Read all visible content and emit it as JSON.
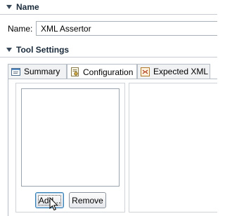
{
  "sections": {
    "name": {
      "title": "Name"
    },
    "tool_settings": {
      "title": "Tool Settings"
    }
  },
  "name_field": {
    "label": "Name:",
    "value": "XML Assertor"
  },
  "tabs": [
    {
      "label": "Summary",
      "icon": "summary-icon"
    },
    {
      "label": "Configuration",
      "icon": "configuration-icon",
      "active": true
    },
    {
      "label": "Expected XML",
      "icon": "expected-xml-icon"
    }
  ],
  "buttons": {
    "add": "Add...",
    "remove": "Remove"
  }
}
